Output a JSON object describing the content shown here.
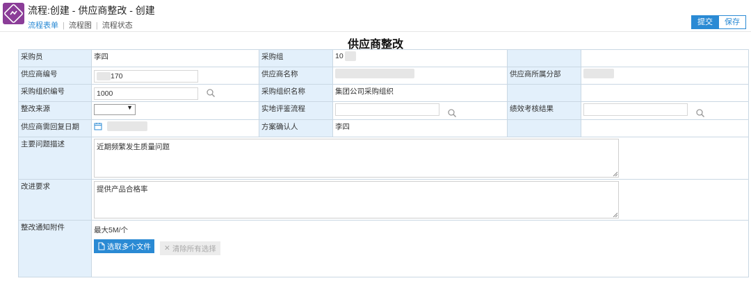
{
  "header": {
    "title": "流程:创建 - 供应商整改 - 创建",
    "nav": [
      {
        "label": "流程表单",
        "active": true
      },
      {
        "label": "流程图",
        "active": false
      },
      {
        "label": "流程状态",
        "active": false
      }
    ],
    "submit_label": "提交",
    "save_label": "保存"
  },
  "form": {
    "title": "供应商整改",
    "rows": [
      {
        "l1": "采购员",
        "v1": "李四",
        "l2": "采购组",
        "v2": "10",
        "l3": "",
        "v3": ""
      },
      {
        "l1": "供应商编号",
        "v1": "170",
        "l2": "供应商名称",
        "v2": "",
        "l3": "供应商所属分部",
        "v3": ""
      },
      {
        "l1": "采购组织编号",
        "v1": "1000",
        "l2": "采购组织名称",
        "v2": "集团公司采购组织",
        "l3": "",
        "v3": ""
      },
      {
        "l1": "整改来源",
        "v1": "",
        "l2": "实地评鉴流程",
        "v2": "",
        "l3": "绩效考核结果",
        "v3": ""
      },
      {
        "l1": "供应商需回复日期",
        "v1": "",
        "l2": "方案确认人",
        "v2": "李四",
        "l3": "",
        "v3": ""
      }
    ],
    "problem": {
      "label": "主要问题描述",
      "value": "近期频繁发生质量问题"
    },
    "improve": {
      "label": "改进要求",
      "value": "提供产品合格率"
    },
    "attachment": {
      "label": "整改通知附件",
      "hint": "最大5M/个",
      "pick_label": "选取多个文件",
      "clear_label": "清除所有选择"
    }
  },
  "colors": {
    "accent": "#2a8ad4",
    "label_bg": "#e3f0fb",
    "icon_bg": "#8b3d98"
  }
}
